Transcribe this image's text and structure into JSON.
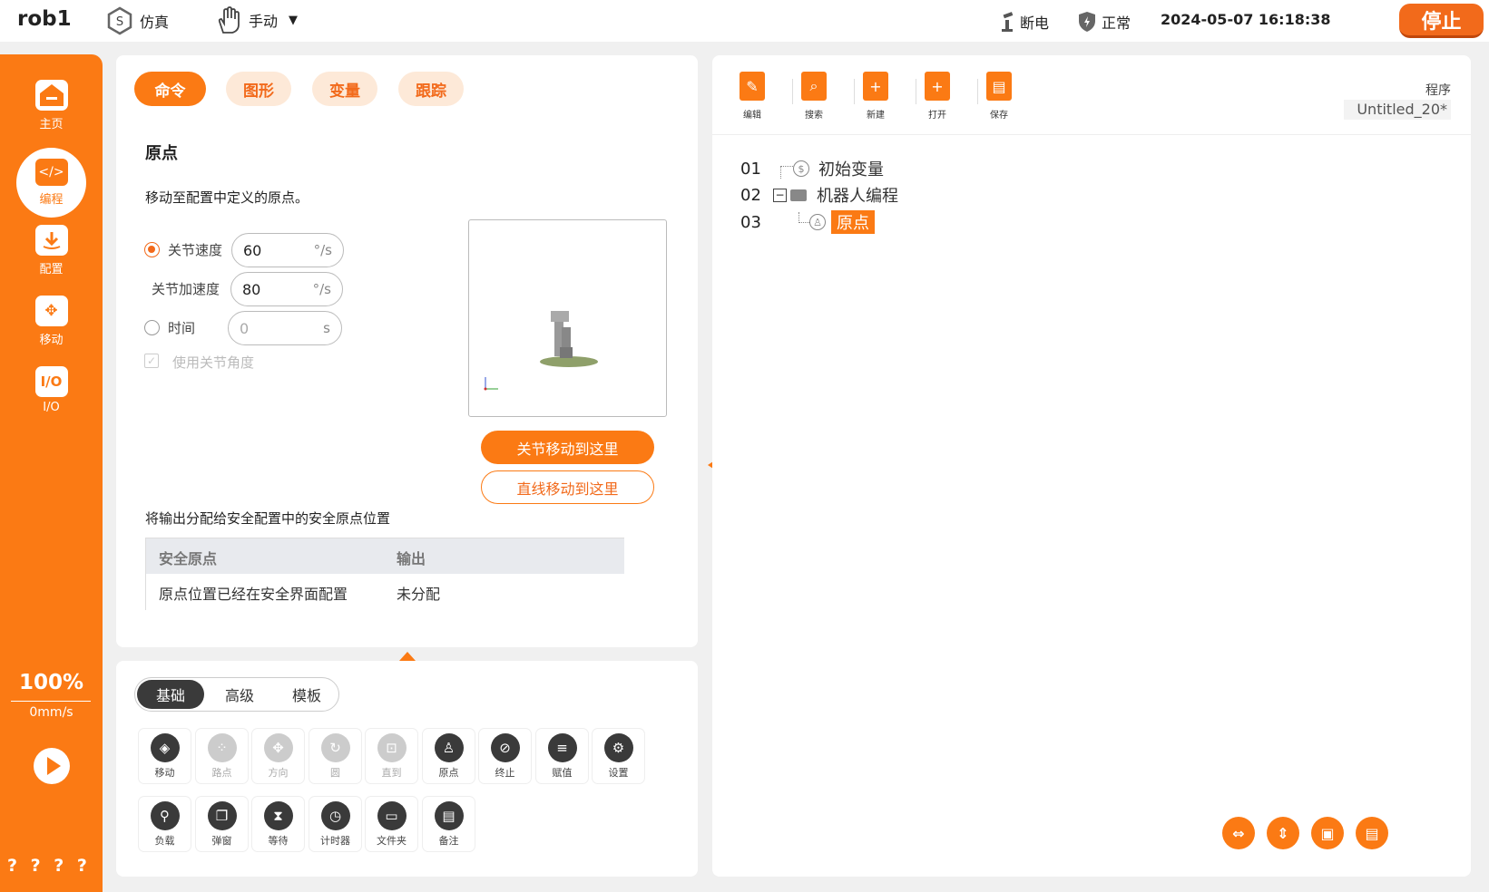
{
  "header": {
    "robot_name": "rob1",
    "mode_sim": "仿真",
    "mode_manual": "手动",
    "power_status": "断电",
    "safety_status": "正常",
    "datetime": "2024-05-07 16:18:38",
    "stop_label": "停止"
  },
  "sidebar": {
    "items": [
      {
        "label": "主页",
        "icon": "home-icon"
      },
      {
        "label": "编程",
        "icon": "code-icon"
      },
      {
        "label": "配置",
        "icon": "download-icon"
      },
      {
        "label": "移动",
        "icon": "move-icon"
      },
      {
        "label": "I/O",
        "icon": "io-icon"
      }
    ],
    "speed_percent": "100%",
    "speed_value": "0mm/s",
    "help": "? ? ? ?"
  },
  "command_panel": {
    "tabs": [
      "命令",
      "图形",
      "变量",
      "跟踪"
    ],
    "title": "原点",
    "description": "移动至配置中定义的原点。",
    "joint_speed_label": "关节速度",
    "joint_speed_value": "60",
    "joint_speed_unit": "°/s",
    "joint_acc_label": "关节加速度",
    "joint_acc_value": "80",
    "joint_acc_unit": "°/s",
    "time_label": "时间",
    "time_value": "0",
    "time_unit": "s",
    "use_joint_angle_label": "使用关节角度",
    "move_joint_button": "关节移动到这里",
    "move_linear_button": "直线移动到这里",
    "output_desc": "将输出分配给安全配置中的安全原点位置",
    "table": {
      "headers": [
        "安全原点",
        "输出"
      ],
      "rows": [
        [
          "原点位置已经在安全界面配置",
          "未分配"
        ]
      ]
    }
  },
  "tool_panel": {
    "tabs": [
      "基础",
      "高级",
      "模板"
    ],
    "tools_row1": [
      {
        "label": "移动",
        "icon": "move-shield-icon",
        "enabled": true
      },
      {
        "label": "路点",
        "icon": "waypoint-icon",
        "enabled": false
      },
      {
        "label": "方向",
        "icon": "direction-icon",
        "enabled": false
      },
      {
        "label": "圆",
        "icon": "circle-icon",
        "enabled": false
      },
      {
        "label": "直到",
        "icon": "until-icon",
        "enabled": false
      },
      {
        "label": "原点",
        "icon": "home-position-icon",
        "enabled": true
      },
      {
        "label": "终止",
        "icon": "stop-icon",
        "enabled": true
      },
      {
        "label": "赋值",
        "icon": "assign-icon",
        "enabled": true
      },
      {
        "label": "设置",
        "icon": "settings-icon",
        "enabled": true
      }
    ],
    "tools_row2": [
      {
        "label": "负载",
        "icon": "payload-icon",
        "enabled": true
      },
      {
        "label": "弹窗",
        "icon": "popup-icon",
        "enabled": true
      },
      {
        "label": "等待",
        "icon": "hourglass-icon",
        "enabled": true
      },
      {
        "label": "计时器",
        "icon": "timer-icon",
        "enabled": true
      },
      {
        "label": "文件夹",
        "icon": "folder-icon",
        "enabled": true
      },
      {
        "label": "备注",
        "icon": "comment-icon",
        "enabled": true
      }
    ]
  },
  "program_panel": {
    "toolbar": [
      "编辑",
      "搜索",
      "新建",
      "打开",
      "保存"
    ],
    "program_label": "程序",
    "program_name": "Untitled_20*",
    "tree": [
      {
        "line": "01",
        "label": "初始变量"
      },
      {
        "line": "02",
        "label": "机器人编程"
      },
      {
        "line": "03",
        "label": "原点"
      }
    ]
  },
  "colors": {
    "accent": "#fb7a14",
    "accent_dark": "#f26a1b"
  }
}
